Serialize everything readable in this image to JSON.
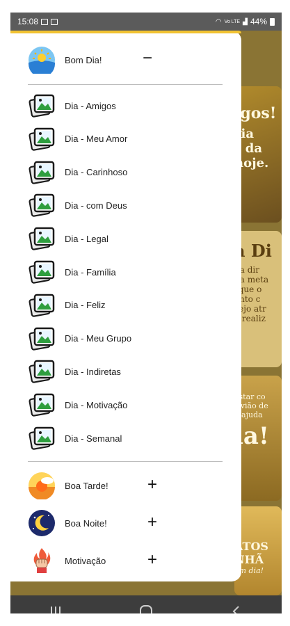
{
  "status": {
    "time": "15:08",
    "signal_text": "Vo LTE",
    "battery": "44%"
  },
  "drawer": {
    "header_item": {
      "label": "Bom Dia!",
      "toggle": "−",
      "icon": "sun-sea-icon"
    },
    "sub_items": [
      {
        "label": "Dia - Amigos",
        "icon": "image-gallery-icon"
      },
      {
        "label": "Dia - Meu Amor",
        "icon": "image-gallery-icon"
      },
      {
        "label": "Dia - Carinhoso",
        "icon": "image-gallery-icon"
      },
      {
        "label": "Dia - com Deus",
        "icon": "image-gallery-icon"
      },
      {
        "label": "Dia - Legal",
        "icon": "image-gallery-icon"
      },
      {
        "label": "Dia - Família",
        "icon": "image-gallery-icon"
      },
      {
        "label": "Dia - Feliz",
        "icon": "image-gallery-icon"
      },
      {
        "label": "Dia - Meu Grupo",
        "icon": "image-gallery-icon"
      },
      {
        "label": "Dia - Indiretas",
        "icon": "image-gallery-icon"
      },
      {
        "label": "Dia - Motivação",
        "icon": "image-gallery-icon"
      },
      {
        "label": "Dia - Semanal",
        "icon": "image-gallery-icon"
      }
    ],
    "categories": [
      {
        "label": "Boa Tarde!",
        "toggle": "+",
        "icon": "sunset-icon"
      },
      {
        "label": "Boa Noite!",
        "toggle": "+",
        "icon": "moon-icon"
      },
      {
        "label": "Motivação",
        "toggle": "+",
        "icon": "fist-fire-icon"
      }
    ]
  },
  "background": {
    "card1": [
      "igos!",
      "ria",
      "r da",
      "hoje."
    ],
    "card2": [
      "a Di",
      "na dir",
      "ua meta",
      "rque o",
      "ento c",
      "sejo atr",
      "e realiz"
    ],
    "card3": [
      "estar co",
      "rivião de",
      "a ajuda",
      "ia!"
    ],
    "card4": [
      "ATOS",
      "NHÃ",
      "om dia!"
    ]
  },
  "colors": {
    "accent": "#f1c232",
    "bg": "#8a7434"
  }
}
